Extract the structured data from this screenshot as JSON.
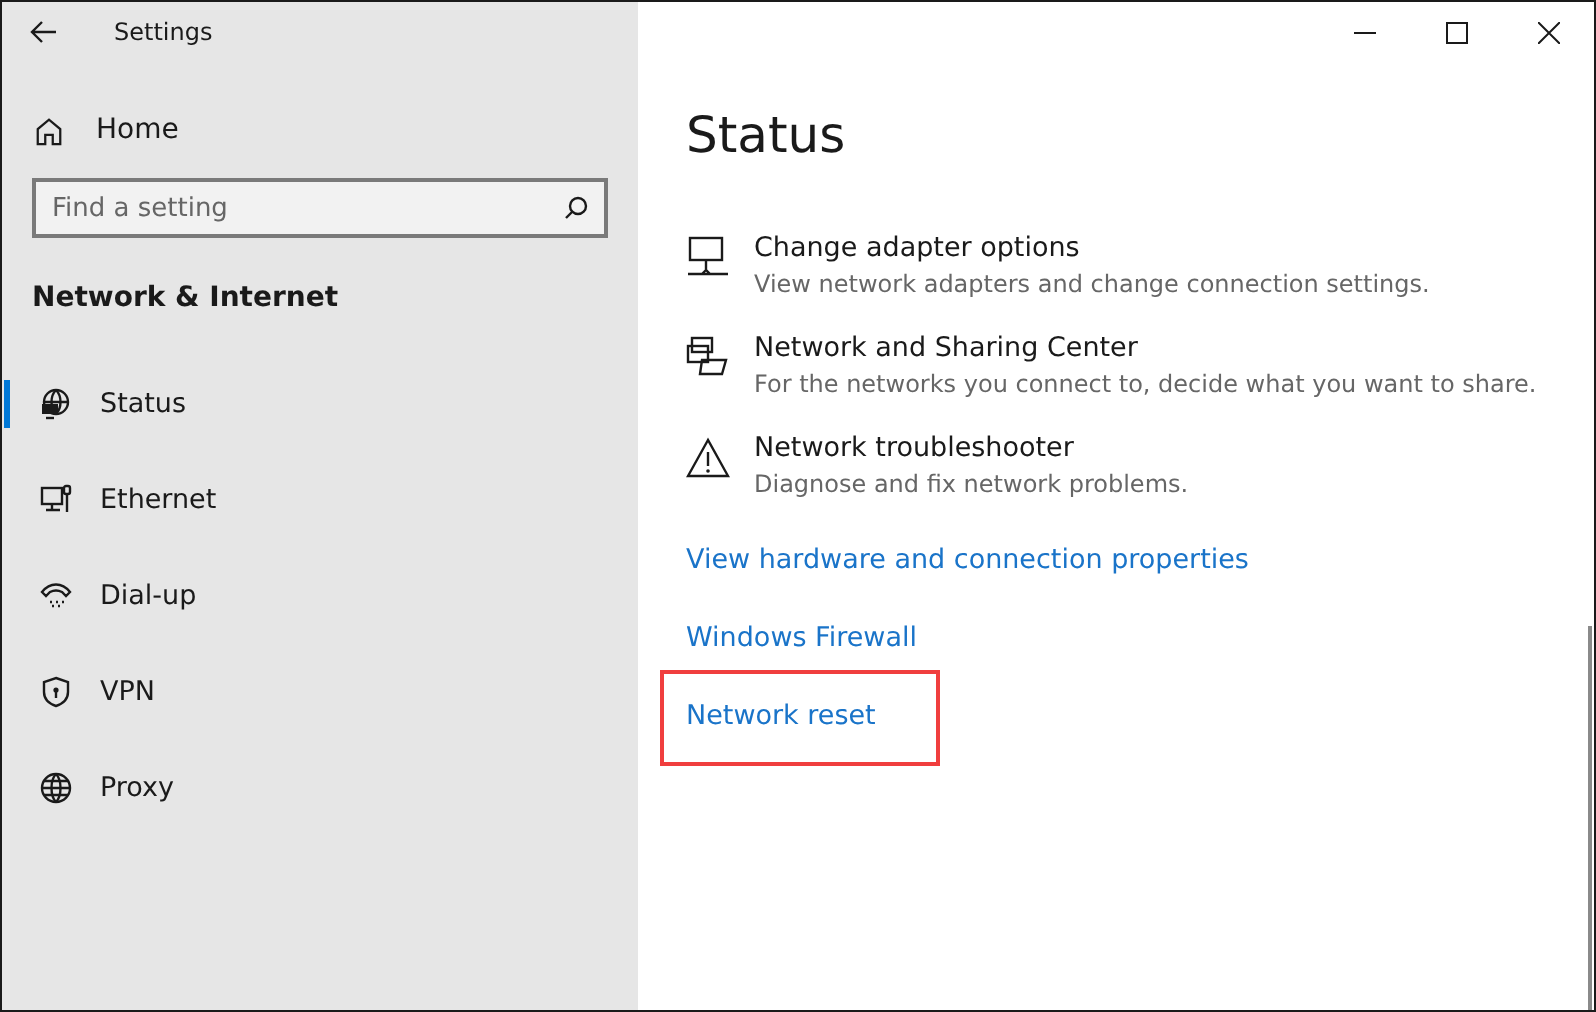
{
  "window": {
    "title": "Settings"
  },
  "sidebar": {
    "home": "Home",
    "search": {
      "placeholder": "Find a setting"
    },
    "section": "Network & Internet",
    "items": [
      {
        "label": "Status",
        "selected": true
      },
      {
        "label": "Ethernet",
        "selected": false
      },
      {
        "label": "Dial-up",
        "selected": false
      },
      {
        "label": "VPN",
        "selected": false
      },
      {
        "label": "Proxy",
        "selected": false
      }
    ]
  },
  "main": {
    "heading": "Status",
    "options": [
      {
        "title": "Change adapter options",
        "description": "View network adapters and change connection settings."
      },
      {
        "title": "Network and Sharing Center",
        "description": "For the networks you connect to, decide what you want to share."
      },
      {
        "title": "Network troubleshooter",
        "description": "Diagnose and fix network problems."
      }
    ],
    "links": [
      {
        "label": "View hardware and connection properties",
        "highlighted": false
      },
      {
        "label": "Windows Firewall",
        "highlighted": false
      },
      {
        "label": "Network reset",
        "highlighted": true
      }
    ]
  }
}
